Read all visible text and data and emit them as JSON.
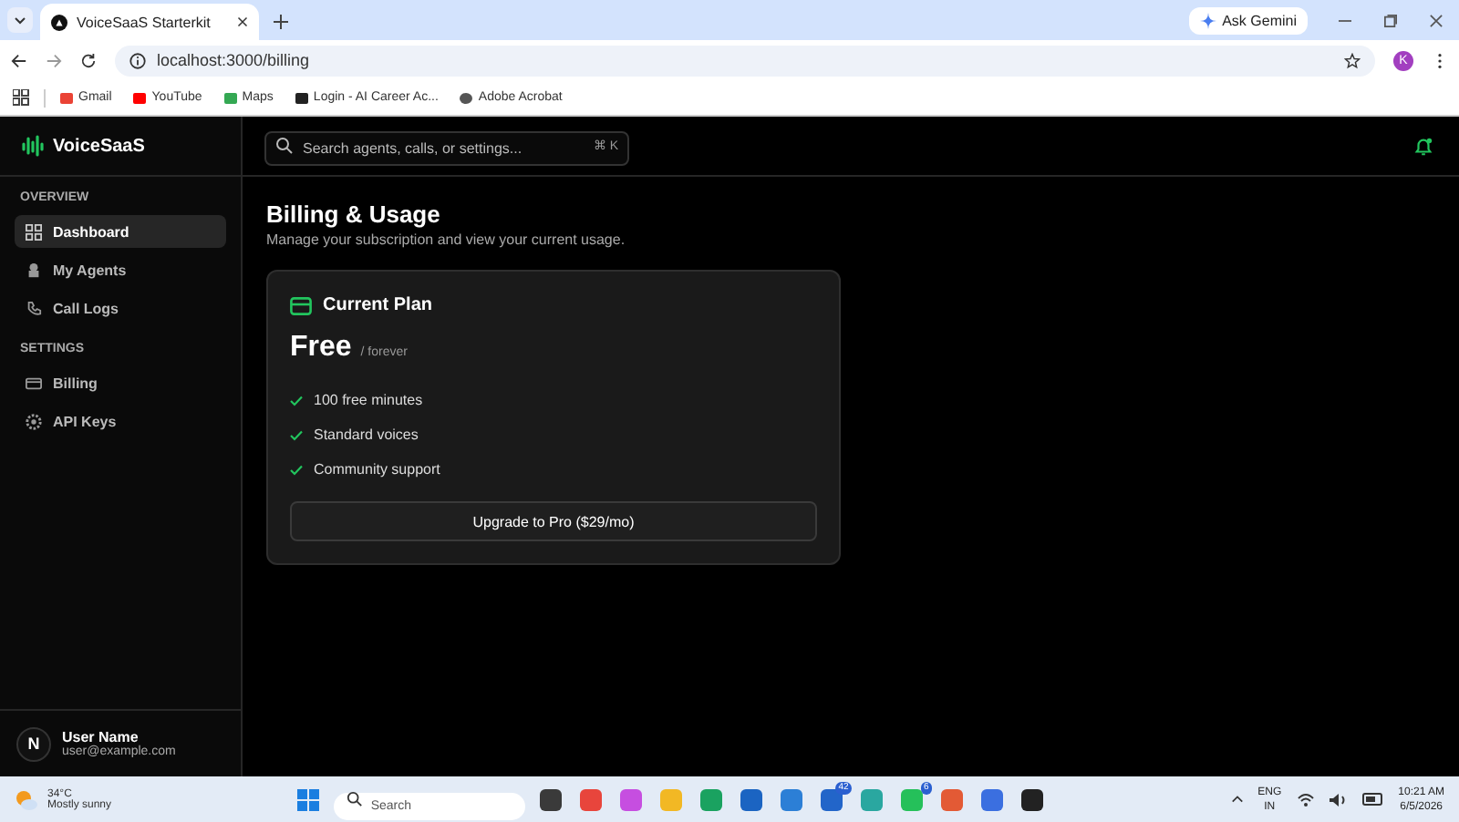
{
  "browser": {
    "tab_title": "VoiceSaaS Starterkit",
    "url": "localhost:3000/billing",
    "ask_gemini": "Ask Gemini",
    "profile_initial": "K",
    "bookmarks": [
      "Gmail",
      "YouTube",
      "Maps",
      "Login - AI Career Ac...",
      "Adobe Acrobat"
    ]
  },
  "app": {
    "brand": "VoiceSaaS",
    "search": {
      "placeholder": "Search agents, calls, or settings...",
      "shortcut": "⌘ K"
    },
    "sidebar": {
      "sections": [
        {
          "title": "OVERVIEW",
          "items": [
            {
              "label": "Dashboard",
              "selected": true
            },
            {
              "label": "My Agents",
              "selected": false
            },
            {
              "label": "Call Logs",
              "selected": false
            }
          ]
        },
        {
          "title": "SETTINGS",
          "items": [
            {
              "label": "Billing",
              "selected": false
            },
            {
              "label": "API Keys",
              "selected": false
            }
          ]
        }
      ],
      "user": {
        "initial": "N",
        "name": "User Name",
        "email": "user@example.com"
      }
    },
    "page": {
      "title": "Billing & Usage",
      "subtitle": "Manage your subscription and view your current usage.",
      "plan_card": {
        "heading": "Current Plan",
        "plan": "Free",
        "period": "/ forever",
        "features": [
          "100 free minutes",
          "Standard voices",
          "Community support"
        ],
        "button": "Upgrade to Pro ($29/mo)"
      }
    }
  },
  "taskbar": {
    "weather": {
      "temp": "34°C",
      "condition": "Mostly sunny"
    },
    "search_placeholder": "Search",
    "apps": [
      {
        "kind": "plain",
        "color": "#3a3a3a"
      },
      {
        "kind": "plain",
        "color": "#e8453c"
      },
      {
        "kind": "plain",
        "color": "#c64ee0"
      },
      {
        "kind": "plain",
        "color": "#f2b824"
      },
      {
        "kind": "plain",
        "color": "#1aa260"
      },
      {
        "kind": "plain",
        "color": "#1b64c2"
      },
      {
        "kind": "plain",
        "color": "#2c7fd6"
      },
      {
        "kind": "badge",
        "color": "#2265c9",
        "badge": "42"
      },
      {
        "kind": "plain",
        "color": "#2aa7a0"
      },
      {
        "kind": "badge",
        "color": "#25c05a",
        "badge": "6"
      },
      {
        "kind": "plain",
        "color": "#e35a35"
      },
      {
        "kind": "plain",
        "color": "#3b6fe0"
      },
      {
        "kind": "plain",
        "color": "#222222"
      }
    ],
    "lang": [
      "ENG",
      "IN"
    ],
    "time": "10:21 AM",
    "date": "6/5/2026"
  }
}
